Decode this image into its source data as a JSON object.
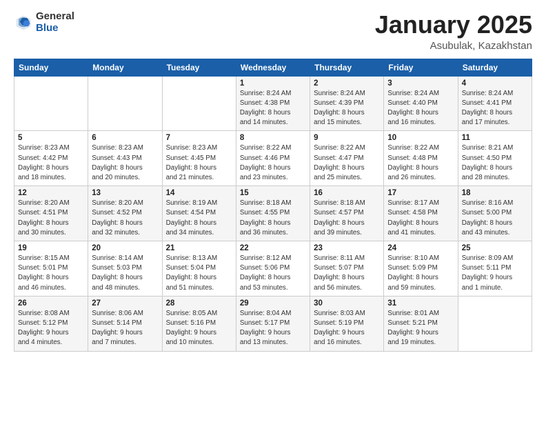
{
  "logo": {
    "general": "General",
    "blue": "Blue"
  },
  "header": {
    "title": "January 2025",
    "subtitle": "Asubulak, Kazakhstan"
  },
  "weekdays": [
    "Sunday",
    "Monday",
    "Tuesday",
    "Wednesday",
    "Thursday",
    "Friday",
    "Saturday"
  ],
  "weeks": [
    [
      {
        "day": "",
        "info": ""
      },
      {
        "day": "",
        "info": ""
      },
      {
        "day": "",
        "info": ""
      },
      {
        "day": "1",
        "info": "Sunrise: 8:24 AM\nSunset: 4:38 PM\nDaylight: 8 hours\nand 14 minutes."
      },
      {
        "day": "2",
        "info": "Sunrise: 8:24 AM\nSunset: 4:39 PM\nDaylight: 8 hours\nand 15 minutes."
      },
      {
        "day": "3",
        "info": "Sunrise: 8:24 AM\nSunset: 4:40 PM\nDaylight: 8 hours\nand 16 minutes."
      },
      {
        "day": "4",
        "info": "Sunrise: 8:24 AM\nSunset: 4:41 PM\nDaylight: 8 hours\nand 17 minutes."
      }
    ],
    [
      {
        "day": "5",
        "info": "Sunrise: 8:23 AM\nSunset: 4:42 PM\nDaylight: 8 hours\nand 18 minutes."
      },
      {
        "day": "6",
        "info": "Sunrise: 8:23 AM\nSunset: 4:43 PM\nDaylight: 8 hours\nand 20 minutes."
      },
      {
        "day": "7",
        "info": "Sunrise: 8:23 AM\nSunset: 4:45 PM\nDaylight: 8 hours\nand 21 minutes."
      },
      {
        "day": "8",
        "info": "Sunrise: 8:22 AM\nSunset: 4:46 PM\nDaylight: 8 hours\nand 23 minutes."
      },
      {
        "day": "9",
        "info": "Sunrise: 8:22 AM\nSunset: 4:47 PM\nDaylight: 8 hours\nand 25 minutes."
      },
      {
        "day": "10",
        "info": "Sunrise: 8:22 AM\nSunset: 4:48 PM\nDaylight: 8 hours\nand 26 minutes."
      },
      {
        "day": "11",
        "info": "Sunrise: 8:21 AM\nSunset: 4:50 PM\nDaylight: 8 hours\nand 28 minutes."
      }
    ],
    [
      {
        "day": "12",
        "info": "Sunrise: 8:20 AM\nSunset: 4:51 PM\nDaylight: 8 hours\nand 30 minutes."
      },
      {
        "day": "13",
        "info": "Sunrise: 8:20 AM\nSunset: 4:52 PM\nDaylight: 8 hours\nand 32 minutes."
      },
      {
        "day": "14",
        "info": "Sunrise: 8:19 AM\nSunset: 4:54 PM\nDaylight: 8 hours\nand 34 minutes."
      },
      {
        "day": "15",
        "info": "Sunrise: 8:18 AM\nSunset: 4:55 PM\nDaylight: 8 hours\nand 36 minutes."
      },
      {
        "day": "16",
        "info": "Sunrise: 8:18 AM\nSunset: 4:57 PM\nDaylight: 8 hours\nand 39 minutes."
      },
      {
        "day": "17",
        "info": "Sunrise: 8:17 AM\nSunset: 4:58 PM\nDaylight: 8 hours\nand 41 minutes."
      },
      {
        "day": "18",
        "info": "Sunrise: 8:16 AM\nSunset: 5:00 PM\nDaylight: 8 hours\nand 43 minutes."
      }
    ],
    [
      {
        "day": "19",
        "info": "Sunrise: 8:15 AM\nSunset: 5:01 PM\nDaylight: 8 hours\nand 46 minutes."
      },
      {
        "day": "20",
        "info": "Sunrise: 8:14 AM\nSunset: 5:03 PM\nDaylight: 8 hours\nand 48 minutes."
      },
      {
        "day": "21",
        "info": "Sunrise: 8:13 AM\nSunset: 5:04 PM\nDaylight: 8 hours\nand 51 minutes."
      },
      {
        "day": "22",
        "info": "Sunrise: 8:12 AM\nSunset: 5:06 PM\nDaylight: 8 hours\nand 53 minutes."
      },
      {
        "day": "23",
        "info": "Sunrise: 8:11 AM\nSunset: 5:07 PM\nDaylight: 8 hours\nand 56 minutes."
      },
      {
        "day": "24",
        "info": "Sunrise: 8:10 AM\nSunset: 5:09 PM\nDaylight: 8 hours\nand 59 minutes."
      },
      {
        "day": "25",
        "info": "Sunrise: 8:09 AM\nSunset: 5:11 PM\nDaylight: 9 hours\nand 1 minute."
      }
    ],
    [
      {
        "day": "26",
        "info": "Sunrise: 8:08 AM\nSunset: 5:12 PM\nDaylight: 9 hours\nand 4 minutes."
      },
      {
        "day": "27",
        "info": "Sunrise: 8:06 AM\nSunset: 5:14 PM\nDaylight: 9 hours\nand 7 minutes."
      },
      {
        "day": "28",
        "info": "Sunrise: 8:05 AM\nSunset: 5:16 PM\nDaylight: 9 hours\nand 10 minutes."
      },
      {
        "day": "29",
        "info": "Sunrise: 8:04 AM\nSunset: 5:17 PM\nDaylight: 9 hours\nand 13 minutes."
      },
      {
        "day": "30",
        "info": "Sunrise: 8:03 AM\nSunset: 5:19 PM\nDaylight: 9 hours\nand 16 minutes."
      },
      {
        "day": "31",
        "info": "Sunrise: 8:01 AM\nSunset: 5:21 PM\nDaylight: 9 hours\nand 19 minutes."
      },
      {
        "day": "",
        "info": ""
      }
    ]
  ]
}
